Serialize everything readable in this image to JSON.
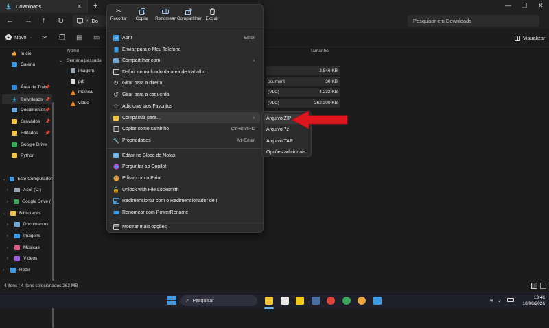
{
  "window": {
    "tab_title": "Downloads",
    "new_tab": "+",
    "minimize": "—",
    "maximize": "❐",
    "close": "✕"
  },
  "nav": {
    "address_prefix": "Do",
    "search_placeholder": "Pesquisar em Downloads"
  },
  "command_bar": {
    "new_label": "Novo",
    "view_label": "Visualizar"
  },
  "sidebar": {
    "items": [
      {
        "label": "Início"
      },
      {
        "label": "Galeria"
      },
      {
        "label": "Área de Trab"
      },
      {
        "label": "Downloads"
      },
      {
        "label": "Documentos"
      },
      {
        "label": "Gravados"
      },
      {
        "label": "Editados"
      },
      {
        "label": "Google Drive"
      },
      {
        "label": "Python"
      },
      {
        "label": "Este Computador"
      },
      {
        "label": "Acer (C:)"
      },
      {
        "label": "Google Drive ("
      },
      {
        "label": "Bibliotecas"
      },
      {
        "label": "Documentos"
      },
      {
        "label": "Imagens"
      },
      {
        "label": "Músicas"
      },
      {
        "label": "Vídeos"
      },
      {
        "label": "Rede"
      }
    ]
  },
  "list": {
    "col_name": "Nome",
    "col_size": "Tamanho",
    "group": "Semana passada",
    "rows": [
      {
        "name": "imagem",
        "type": "",
        "size": "2.546 KB"
      },
      {
        "name": "pdf",
        "type": "ocument",
        "size": "30 KB"
      },
      {
        "name": "música",
        "type": "(VLC)",
        "size": "4.232 KB"
      },
      {
        "name": "vídeo",
        "type": "(VLC)",
        "size": "262.300 KB"
      }
    ]
  },
  "status": {
    "text": "4 itens  |  4 itens selecionados 262 MB"
  },
  "context_menu": {
    "top_actions": [
      {
        "label": "Recortar",
        "icon": "scissors-icon"
      },
      {
        "label": "Copiar",
        "icon": "copy-icon"
      },
      {
        "label": "Renomear",
        "icon": "rename-icon"
      },
      {
        "label": "Compartilhar",
        "icon": "share-icon"
      },
      {
        "label": "Excluir",
        "icon": "trash-icon"
      }
    ],
    "items": [
      {
        "label": "Abrir",
        "shortcut": "Enter"
      },
      {
        "label": "Enviar para o Meu Telefone",
        "shortcut": ""
      },
      {
        "label": "Compartilhar com",
        "shortcut": "›"
      },
      {
        "label": "Definir como fundo da área de trabalho",
        "shortcut": ""
      },
      {
        "label": "Girar para a direita",
        "shortcut": ""
      },
      {
        "label": "Girar para a esquerda",
        "shortcut": ""
      },
      {
        "label": "Adicionar aos Favoritos",
        "shortcut": ""
      },
      {
        "label": "Compactar para...",
        "shortcut": "›"
      },
      {
        "label": "Copiar como caminho",
        "shortcut": "Ctrl+Shift+C"
      },
      {
        "label": "Propriedades",
        "shortcut": "Alt+Enter"
      },
      {
        "label": "Editar no Bloco de Notas",
        "shortcut": ""
      },
      {
        "label": "Perguntar ao Copilot",
        "shortcut": ""
      },
      {
        "label": "Editar com o Paint",
        "shortcut": ""
      },
      {
        "label": "Unlock with File Locksmith",
        "shortcut": ""
      },
      {
        "label": "Redimensionar com o Redimensionador de I",
        "shortcut": ""
      },
      {
        "label": "Renomear com PowerRename",
        "shortcut": ""
      },
      {
        "label": "Mostrar mais opções",
        "shortcut": ""
      }
    ]
  },
  "submenu": {
    "items": [
      {
        "label": "Arquivo ZIP"
      },
      {
        "label": "Arquivo 7z"
      },
      {
        "label": "Arquivo TAR"
      },
      {
        "label": "Opções adicionais"
      }
    ]
  },
  "taskbar": {
    "search_label": "Pesquisar",
    "time": "13:46",
    "date": "10/08/2026"
  },
  "colors": {
    "accent": "#0078d4",
    "arrow": "#e0161e",
    "folder": "#f4c542"
  }
}
